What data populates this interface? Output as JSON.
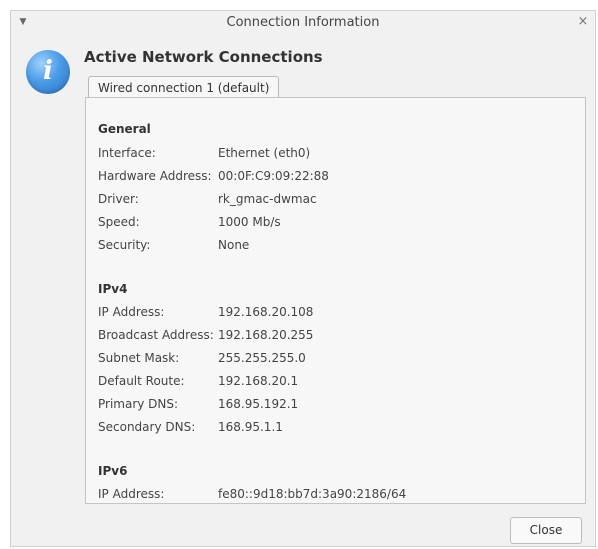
{
  "window": {
    "title": "Connection Information",
    "menu_icon": "chevron-down-icon",
    "close_icon": "close-icon",
    "close_glyph": "×"
  },
  "header": {
    "info_icon": "info-icon",
    "info_glyph": "i",
    "heading": "Active Network Connections"
  },
  "tabs": [
    {
      "label": "Wired connection 1 (default)",
      "selected": true
    }
  ],
  "sections": {
    "general": {
      "title": "General",
      "rows": [
        {
          "label": "Interface:",
          "value": "Ethernet (eth0)"
        },
        {
          "label": "Hardware Address:",
          "value": "00:0F:C9:09:22:88"
        },
        {
          "label": "Driver:",
          "value": "rk_gmac-dwmac"
        },
        {
          "label": "Speed:",
          "value": "1000 Mb/s"
        },
        {
          "label": "Security:",
          "value": "None"
        }
      ]
    },
    "ipv4": {
      "title": "IPv4",
      "rows": [
        {
          "label": "IP Address:",
          "value": "192.168.20.108"
        },
        {
          "label": "Broadcast Address:",
          "value": "192.168.20.255"
        },
        {
          "label": "Subnet Mask:",
          "value": "255.255.255.0"
        },
        {
          "label": "Default Route:",
          "value": "192.168.20.1"
        },
        {
          "label": "Primary DNS:",
          "value": "168.95.192.1"
        },
        {
          "label": "Secondary DNS:",
          "value": "168.95.1.1"
        }
      ]
    },
    "ipv6": {
      "title": "IPv6",
      "rows": [
        {
          "label": "IP Address:",
          "value": "fe80::9d18:bb7d:3a90:2186/64"
        }
      ]
    }
  },
  "buttons": {
    "close_label": "Close"
  },
  "colors": {
    "window_bg": "#f1f1f1",
    "panel_bg": "#f7f7f7",
    "info_icon_blue": "#3b86d8"
  }
}
